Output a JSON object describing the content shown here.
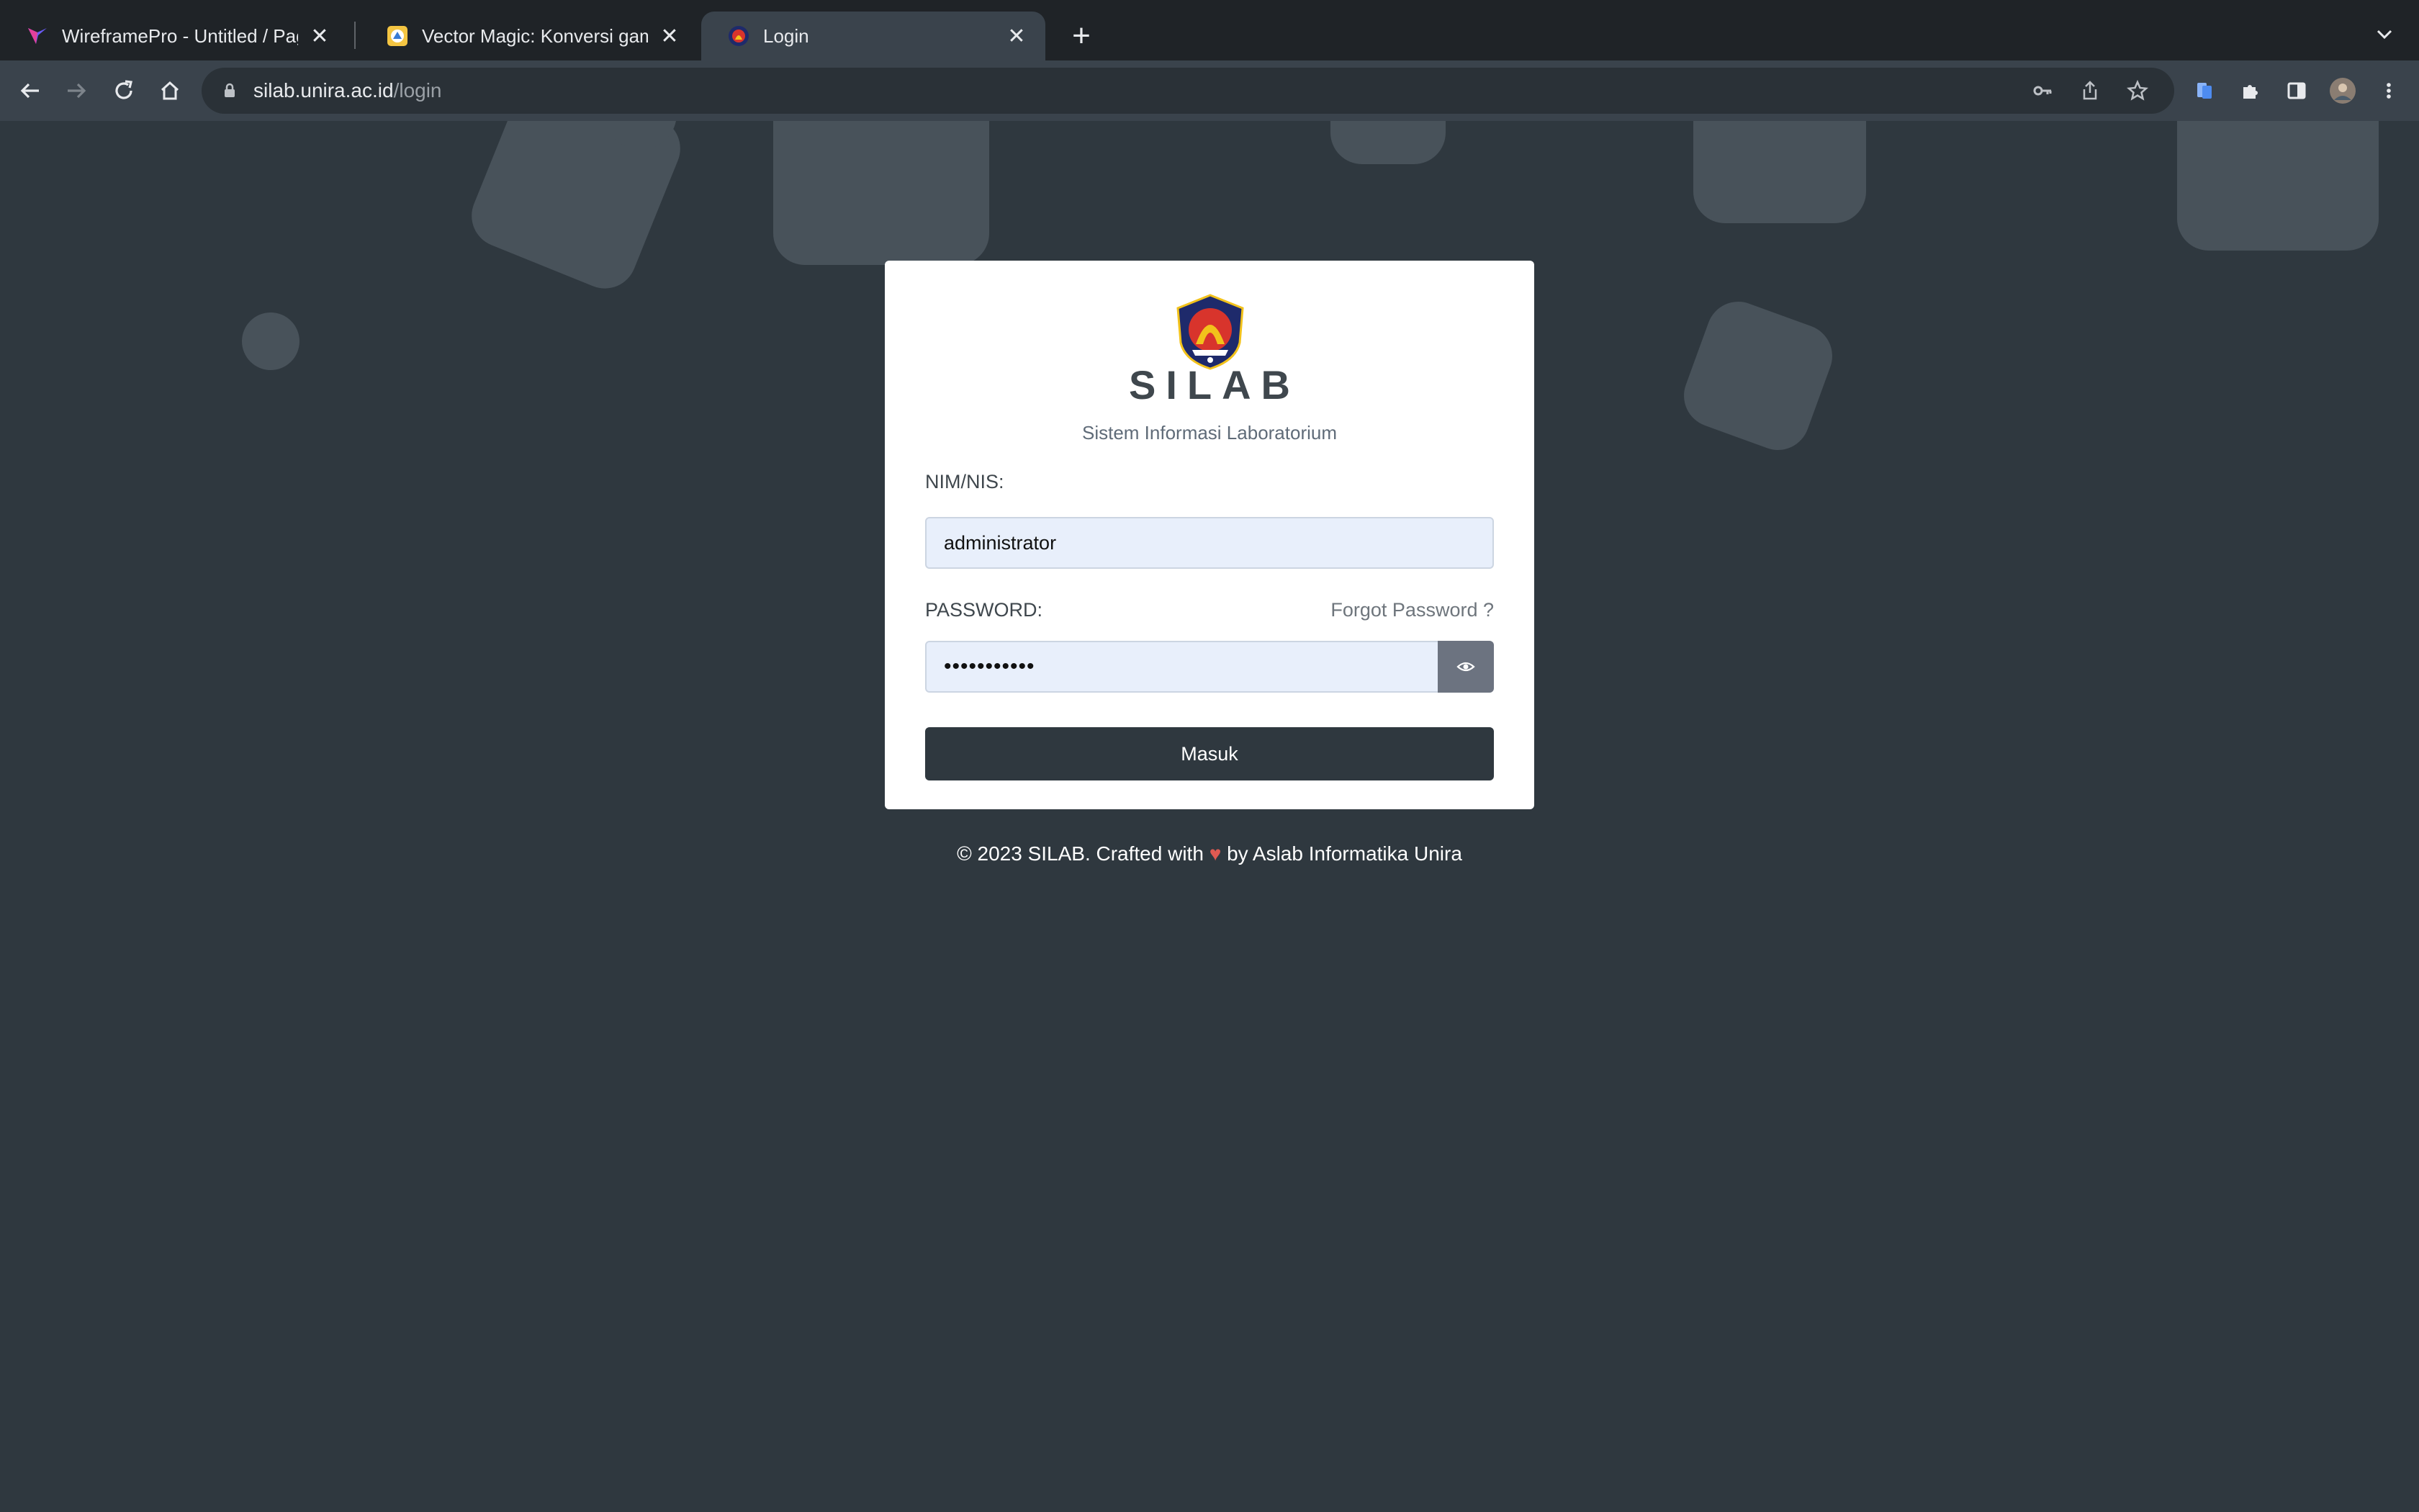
{
  "browser": {
    "tabs": [
      {
        "title": "WireframePro - Untitled / Page",
        "favicon": "wireframepro-logo-icon"
      },
      {
        "title": "Vector Magic: Konversi gambar",
        "favicon": "vector-magic-icon"
      },
      {
        "title": "Login",
        "favicon": "unira-logo-icon"
      }
    ],
    "new_tab": "+",
    "url": {
      "host": "silab.unira.ac.id",
      "path": "/login"
    }
  },
  "login": {
    "brand": "SILAB",
    "subtitle": "Sistem Informasi Laboratorium",
    "nim_label": "NIM/NIS:",
    "nim_value": "administrator",
    "password_label": "PASSWORD:",
    "forgot_link": "Forgot Password ?",
    "password_masked": "•••••••••••",
    "submit_label": "Masuk"
  },
  "footer": {
    "prefix": "© 2023 SILAB. Crafted with",
    "heart": "♥",
    "suffix": "by Aslab Informatika Unira"
  },
  "colors": {
    "background": "#2f383f",
    "card": "#ffffff",
    "input_bg": "#e8effb",
    "button": "#2f383f",
    "heart": "#e05a52"
  }
}
